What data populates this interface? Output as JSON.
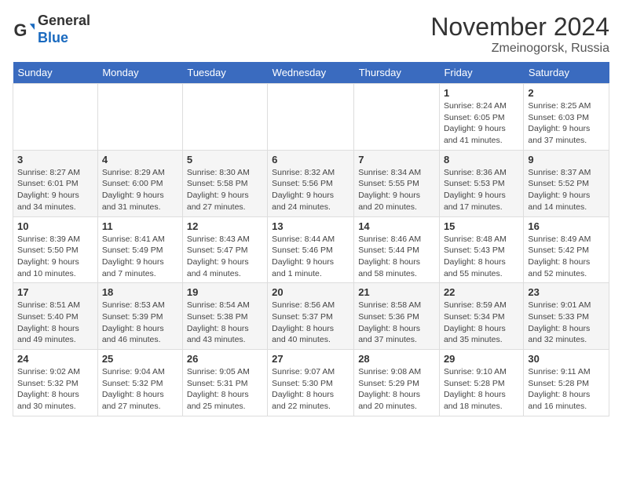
{
  "header": {
    "logo": {
      "general": "General",
      "blue": "Blue"
    },
    "month": "November 2024",
    "location": "Zmeinogorsk, Russia"
  },
  "weekdays": [
    "Sunday",
    "Monday",
    "Tuesday",
    "Wednesday",
    "Thursday",
    "Friday",
    "Saturday"
  ],
  "weeks": [
    [
      {
        "day": "",
        "info": ""
      },
      {
        "day": "",
        "info": ""
      },
      {
        "day": "",
        "info": ""
      },
      {
        "day": "",
        "info": ""
      },
      {
        "day": "",
        "info": ""
      },
      {
        "day": "1",
        "info": "Sunrise: 8:24 AM\nSunset: 6:05 PM\nDaylight: 9 hours and 41 minutes."
      },
      {
        "day": "2",
        "info": "Sunrise: 8:25 AM\nSunset: 6:03 PM\nDaylight: 9 hours and 37 minutes."
      }
    ],
    [
      {
        "day": "3",
        "info": "Sunrise: 8:27 AM\nSunset: 6:01 PM\nDaylight: 9 hours and 34 minutes."
      },
      {
        "day": "4",
        "info": "Sunrise: 8:29 AM\nSunset: 6:00 PM\nDaylight: 9 hours and 31 minutes."
      },
      {
        "day": "5",
        "info": "Sunrise: 8:30 AM\nSunset: 5:58 PM\nDaylight: 9 hours and 27 minutes."
      },
      {
        "day": "6",
        "info": "Sunrise: 8:32 AM\nSunset: 5:56 PM\nDaylight: 9 hours and 24 minutes."
      },
      {
        "day": "7",
        "info": "Sunrise: 8:34 AM\nSunset: 5:55 PM\nDaylight: 9 hours and 20 minutes."
      },
      {
        "day": "8",
        "info": "Sunrise: 8:36 AM\nSunset: 5:53 PM\nDaylight: 9 hours and 17 minutes."
      },
      {
        "day": "9",
        "info": "Sunrise: 8:37 AM\nSunset: 5:52 PM\nDaylight: 9 hours and 14 minutes."
      }
    ],
    [
      {
        "day": "10",
        "info": "Sunrise: 8:39 AM\nSunset: 5:50 PM\nDaylight: 9 hours and 10 minutes."
      },
      {
        "day": "11",
        "info": "Sunrise: 8:41 AM\nSunset: 5:49 PM\nDaylight: 9 hours and 7 minutes."
      },
      {
        "day": "12",
        "info": "Sunrise: 8:43 AM\nSunset: 5:47 PM\nDaylight: 9 hours and 4 minutes."
      },
      {
        "day": "13",
        "info": "Sunrise: 8:44 AM\nSunset: 5:46 PM\nDaylight: 9 hours and 1 minute."
      },
      {
        "day": "14",
        "info": "Sunrise: 8:46 AM\nSunset: 5:44 PM\nDaylight: 8 hours and 58 minutes."
      },
      {
        "day": "15",
        "info": "Sunrise: 8:48 AM\nSunset: 5:43 PM\nDaylight: 8 hours and 55 minutes."
      },
      {
        "day": "16",
        "info": "Sunrise: 8:49 AM\nSunset: 5:42 PM\nDaylight: 8 hours and 52 minutes."
      }
    ],
    [
      {
        "day": "17",
        "info": "Sunrise: 8:51 AM\nSunset: 5:40 PM\nDaylight: 8 hours and 49 minutes."
      },
      {
        "day": "18",
        "info": "Sunrise: 8:53 AM\nSunset: 5:39 PM\nDaylight: 8 hours and 46 minutes."
      },
      {
        "day": "19",
        "info": "Sunrise: 8:54 AM\nSunset: 5:38 PM\nDaylight: 8 hours and 43 minutes."
      },
      {
        "day": "20",
        "info": "Sunrise: 8:56 AM\nSunset: 5:37 PM\nDaylight: 8 hours and 40 minutes."
      },
      {
        "day": "21",
        "info": "Sunrise: 8:58 AM\nSunset: 5:36 PM\nDaylight: 8 hours and 37 minutes."
      },
      {
        "day": "22",
        "info": "Sunrise: 8:59 AM\nSunset: 5:34 PM\nDaylight: 8 hours and 35 minutes."
      },
      {
        "day": "23",
        "info": "Sunrise: 9:01 AM\nSunset: 5:33 PM\nDaylight: 8 hours and 32 minutes."
      }
    ],
    [
      {
        "day": "24",
        "info": "Sunrise: 9:02 AM\nSunset: 5:32 PM\nDaylight: 8 hours and 30 minutes."
      },
      {
        "day": "25",
        "info": "Sunrise: 9:04 AM\nSunset: 5:32 PM\nDaylight: 8 hours and 27 minutes."
      },
      {
        "day": "26",
        "info": "Sunrise: 9:05 AM\nSunset: 5:31 PM\nDaylight: 8 hours and 25 minutes."
      },
      {
        "day": "27",
        "info": "Sunrise: 9:07 AM\nSunset: 5:30 PM\nDaylight: 8 hours and 22 minutes."
      },
      {
        "day": "28",
        "info": "Sunrise: 9:08 AM\nSunset: 5:29 PM\nDaylight: 8 hours and 20 minutes."
      },
      {
        "day": "29",
        "info": "Sunrise: 9:10 AM\nSunset: 5:28 PM\nDaylight: 8 hours and 18 minutes."
      },
      {
        "day": "30",
        "info": "Sunrise: 9:11 AM\nSunset: 5:28 PM\nDaylight: 8 hours and 16 minutes."
      }
    ]
  ]
}
